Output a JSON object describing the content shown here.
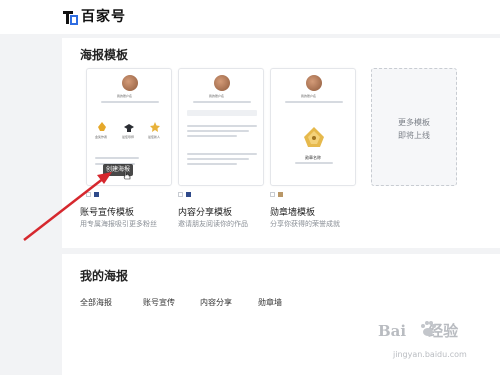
{
  "brand": {
    "name": "百家号"
  },
  "templates_section": {
    "title": "海报模板"
  },
  "templates": [
    {
      "name": "账号宣传模板",
      "desc": "用专属海报吸引更多粉丝",
      "card_account": "我的账户名",
      "card_lines": [
        "金奖作者",
        "最佳导师",
        "最佳新人"
      ]
    },
    {
      "name": "内容分享模板",
      "desc": "邀请朋友阅读你的作品",
      "card_account": "我的账户名"
    },
    {
      "name": "勋章墙模板",
      "desc": "分享你获得的荣誉成就",
      "card_account": "我的账户名",
      "card_badge": "勋章名称"
    }
  ],
  "more": {
    "line1": "更多模板",
    "line2": "即将上线"
  },
  "tooltip": "创建海报",
  "my_posters": {
    "title": "我的海报",
    "tabs": [
      "全部海报",
      "账号宣传",
      "内容分享",
      "勋章墙"
    ]
  },
  "watermark": {
    "main": "Bai",
    "suffix": "经验",
    "sub": "jingyan.baidu.com"
  },
  "colors": {
    "swatch_navy": "#2f4a8a",
    "swatch_gold": "#b99767",
    "arrow": "#d6282e"
  }
}
